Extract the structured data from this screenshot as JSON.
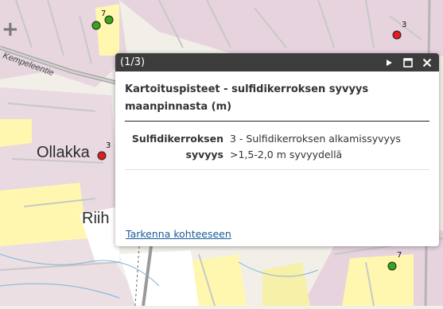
{
  "map": {
    "labels": {
      "road": "Kempeleentie",
      "town1": "Ollakka",
      "town2": "Riih"
    },
    "points": [
      {
        "label": "7",
        "color": "#39a51a"
      },
      {
        "label": "3",
        "color": "#e01e1e"
      },
      {
        "label": "3",
        "color": "#e01e1e"
      },
      {
        "label": "7",
        "color": "#39a51a"
      }
    ],
    "colors": {
      "land": "#f2efe9",
      "pink": "#e8d6df",
      "yellow": "#fff7b0",
      "green": "#dfead0"
    }
  },
  "popup": {
    "counter": "(1/3)",
    "title": "Kartoituspisteet - sulfidikerroksen syvyys maanpinnasta (m)",
    "attribute_name": "Sulfidikerroksen syvyys",
    "attribute_value": "3 - Sulfidikerroksen alkamissyvyys >1,5-2,0 m syvyydellä",
    "zoom_link": "Tarkenna kohteeseen",
    "icons": {
      "next": "play-next-icon",
      "maximize": "maximize-icon",
      "close": "close-icon"
    }
  }
}
